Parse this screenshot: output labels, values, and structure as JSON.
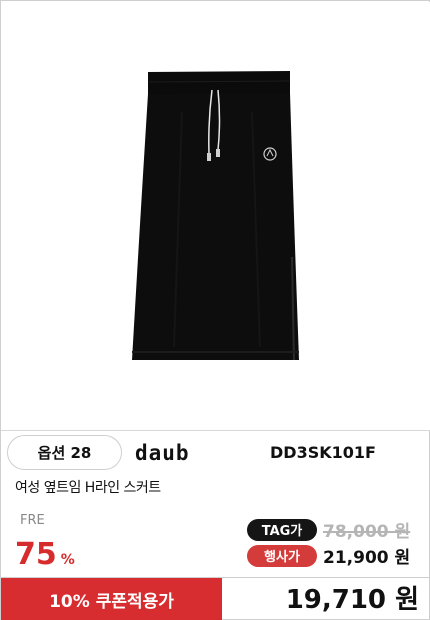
{
  "product": {
    "option_label": "옵션 28",
    "brand": "daub",
    "sku": "DD3SK101F",
    "name": "여성 옆트임 H라인 스커트",
    "size": "FRE"
  },
  "pricing": {
    "discount_number": "75",
    "discount_symbol": "%",
    "tag_badge": "TAG가",
    "tag_price": "78,000 원",
    "sale_badge": "행사가",
    "sale_price": "21,900 원",
    "coupon_label": "10% 쿠폰적용가",
    "final_price": "19,710 원"
  },
  "colors": {
    "accent_red": "#d72d30",
    "badge_dark": "#151515",
    "strike_gray": "#b5b5b5"
  },
  "icons": {
    "product_image": "black-h-line-skirt-photo"
  }
}
